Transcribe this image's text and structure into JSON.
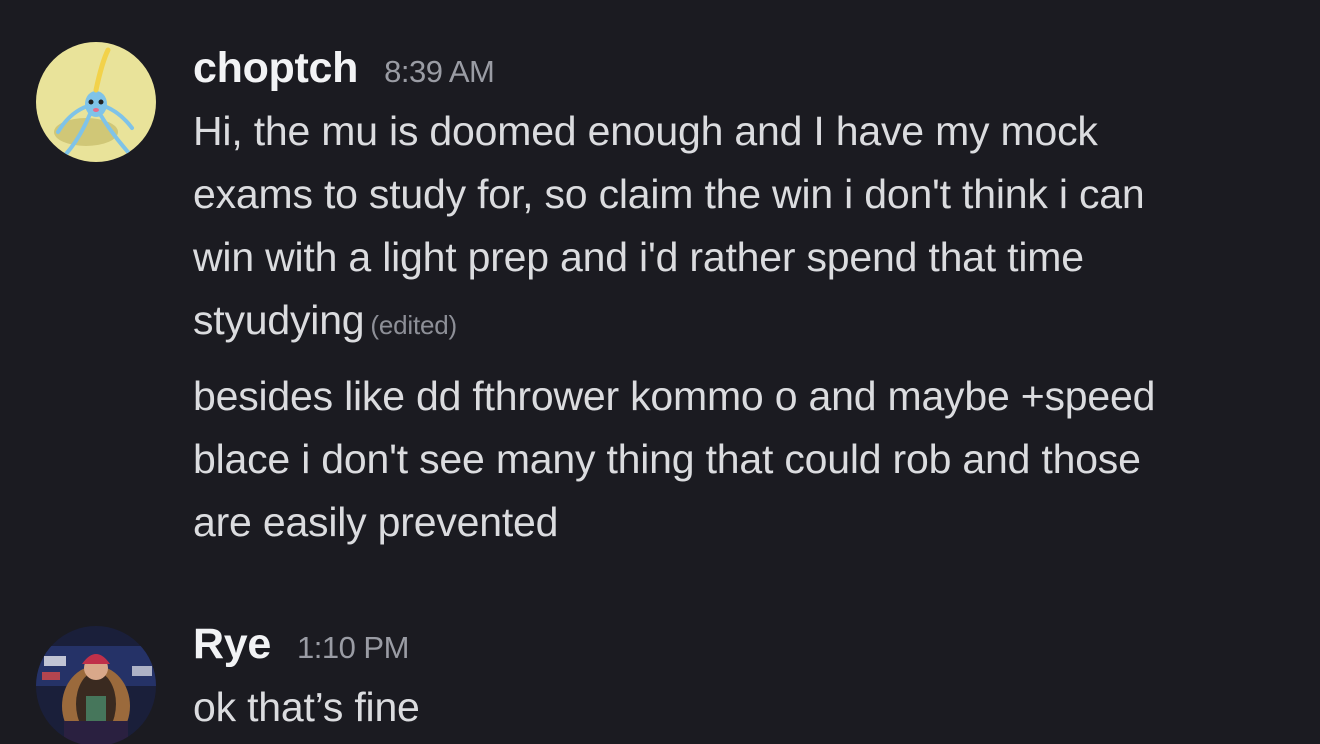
{
  "messages": [
    {
      "username": "choptch",
      "timestamp": "8:39 AM",
      "avatar_icon": "surskit-avatar",
      "groups": [
        {
          "lines": [
            "Hi, the mu is doomed enough and I have my mock",
            "exams to study for, so claim the win i don't think i can",
            "win with a light prep and i'd rather spend that time",
            "styudying"
          ],
          "edited": "(edited)"
        },
        {
          "lines": [
            "besides like dd fthrower kommo o and maybe +speed",
            "blace i don't see many thing that could rob and those",
            "are easily prevented"
          ]
        }
      ]
    },
    {
      "username": "Rye",
      "timestamp": "1:10 PM",
      "avatar_icon": "wrestler-photo-avatar",
      "groups": [
        {
          "lines": [
            "ok that’s fine"
          ]
        }
      ]
    }
  ],
  "colors": {
    "background": "#1b1b21",
    "username": "#f2f3f5",
    "timestamp": "#9a9ca4",
    "body_text": "#dbdcdf",
    "edited": "#8d8f97"
  }
}
